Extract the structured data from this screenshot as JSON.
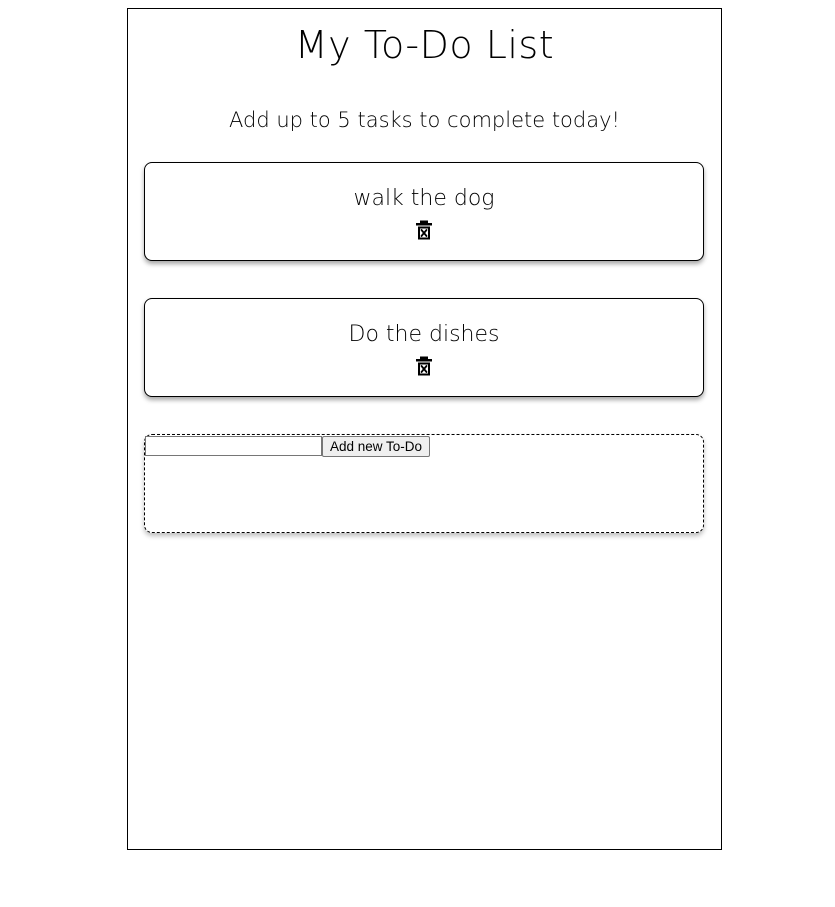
{
  "page": {
    "title": "My To-Do List",
    "subtitle": "Add up to 5 tasks to complete today!"
  },
  "todos": [
    {
      "text": "walk the dog",
      "delete_icon": "trash-x-icon"
    },
    {
      "text": "Do the dishes",
      "delete_icon": "trash-x-icon"
    }
  ],
  "add_form": {
    "input_value": "",
    "input_placeholder": "",
    "button_label": "Add new To-Do"
  },
  "colors": {
    "text": "#000000",
    "background": "#ffffff",
    "border": "#000000",
    "button_bg": "#efefef"
  }
}
